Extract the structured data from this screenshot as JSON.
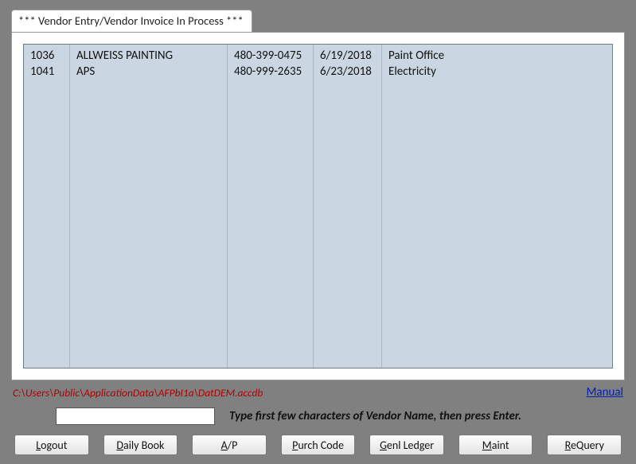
{
  "tab_title": "*** Vendor Entry/Vendor Invoice In Process ***",
  "rows": [
    {
      "id": "1036",
      "name": "ALLWEISS PAINTING",
      "phone": "480-399-0475",
      "date": "6/19/2018",
      "desc": "Paint Office"
    },
    {
      "id": "1041",
      "name": "APS",
      "phone": "480-999-2635",
      "date": "6/23/2018",
      "desc": "Electricity"
    }
  ],
  "filepath": "C:\\Users\\Public\\ApplicationData\\AFPbI1a\\DatDEM.accdb",
  "manual_label": "Manual",
  "search_hint": "Type first few characters of Vendor Name, then press Enter.",
  "search_value": "",
  "buttons": {
    "logout": {
      "u": "L",
      "rest": "ogout"
    },
    "daily_book": {
      "u": "D",
      "rest": "aily Book"
    },
    "ap": {
      "u": "A",
      "rest": "/P"
    },
    "purch_code": {
      "u": "P",
      "rest": "urch Code"
    },
    "genl_ledger": {
      "u": "G",
      "rest": "enl Ledger"
    },
    "maint": {
      "u": "M",
      "rest": "aint"
    },
    "requery": {
      "u": "R",
      "rest": "eQuery"
    }
  }
}
